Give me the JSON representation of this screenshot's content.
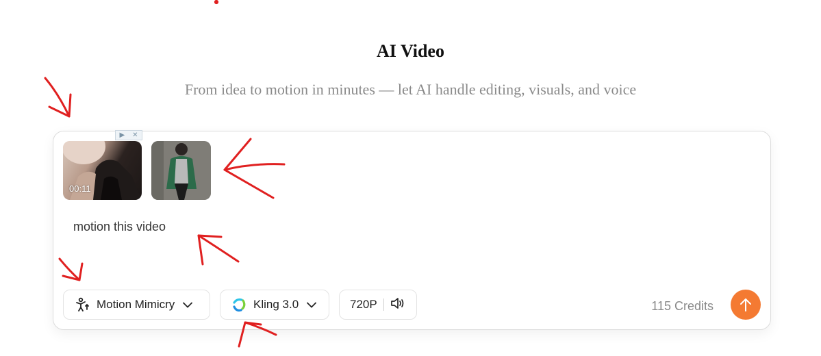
{
  "header": {
    "title": "AI Video",
    "subtitle": "From idea to motion in minutes — let AI handle editing, visuals, and voice"
  },
  "composer": {
    "attachments": [
      {
        "kind": "video",
        "duration": "00:11"
      },
      {
        "kind": "image"
      }
    ],
    "prompt": "motion this video",
    "mode": {
      "label": "Motion Mimicry",
      "icon": "motion-person-icon"
    },
    "model": {
      "label": "Kling 3.0",
      "icon": "kling-logo-icon"
    },
    "resolution": {
      "label": "720P",
      "icon": "speaker-icon"
    },
    "credits": "115 Credits",
    "send_icon": "arrow-up-icon"
  },
  "colors": {
    "accent": "#f47a32",
    "annotation": "#e02020",
    "subtitle": "#8a8a8a"
  }
}
